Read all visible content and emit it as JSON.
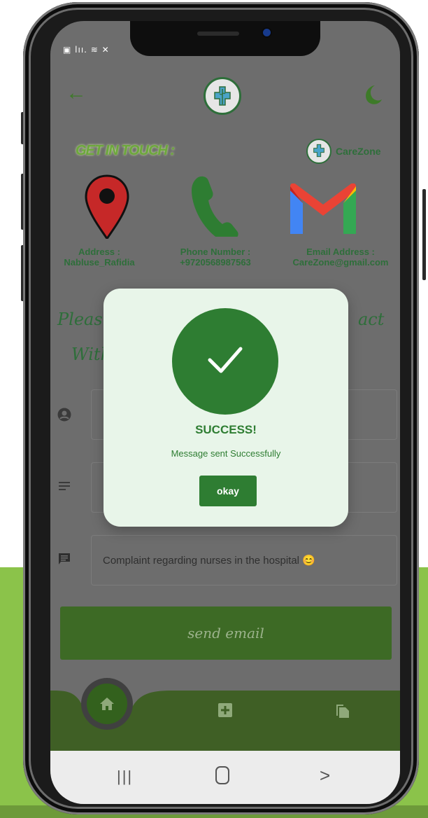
{
  "status_bar": {
    "icons_text": "▣ lıı. ≋ ✕"
  },
  "header": {
    "back_icon": "arrow-left-icon",
    "logo": "carezone-logo",
    "theme_icon": "moon-icon"
  },
  "get_in_touch": "GET IN TOUCH :",
  "brand": {
    "name": "CareZone"
  },
  "contacts": [
    {
      "label": "Address :",
      "value": "Nabluse_Rafidia",
      "icon": "map-pin-icon"
    },
    {
      "label": "Phone Number :",
      "value": "+9720568987563",
      "icon": "phone-icon"
    },
    {
      "label": "Email Address :",
      "value": "CareZone@gmail.com",
      "icon": "gmail-icon"
    }
  ],
  "intro": {
    "line1_start": "Pleas",
    "line1_end": "act",
    "line2_start": "With"
  },
  "form": {
    "message_value": "Complaint regarding nurses in the hospital 😊",
    "send_label": "send email"
  },
  "dialog": {
    "title": "SUCCESS!",
    "message": "Message sent Successfully",
    "okay_label": "okay"
  },
  "bottom_nav": [
    "home-icon",
    "medical-add-icon",
    "documents-icon"
  ],
  "system_nav": {
    "recent": "|||",
    "back": ">"
  },
  "colors": {
    "primary": "#2e7d32",
    "accent_bg": "#8bc34a",
    "dialog_bg": "#e8f5e9"
  }
}
